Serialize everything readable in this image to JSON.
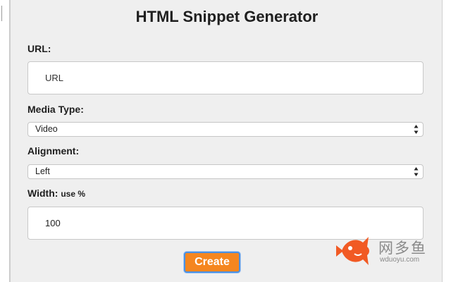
{
  "title": "HTML Snippet Generator",
  "url_field": {
    "label": "URL:",
    "placeholder": "URL",
    "value": ""
  },
  "media_type": {
    "label": "Media Type:",
    "selected": "Video"
  },
  "alignment": {
    "label": "Alignment:",
    "selected": "Left"
  },
  "width_field": {
    "label": "Width:",
    "hint": "use %",
    "value": "100"
  },
  "create_label": "Create",
  "watermark": {
    "name": "网多鱼",
    "domain": "wduoyu.com"
  },
  "colors": {
    "accent": "#f5861f",
    "focus_ring": "#4a90e2",
    "panel_bg": "#efefef"
  }
}
